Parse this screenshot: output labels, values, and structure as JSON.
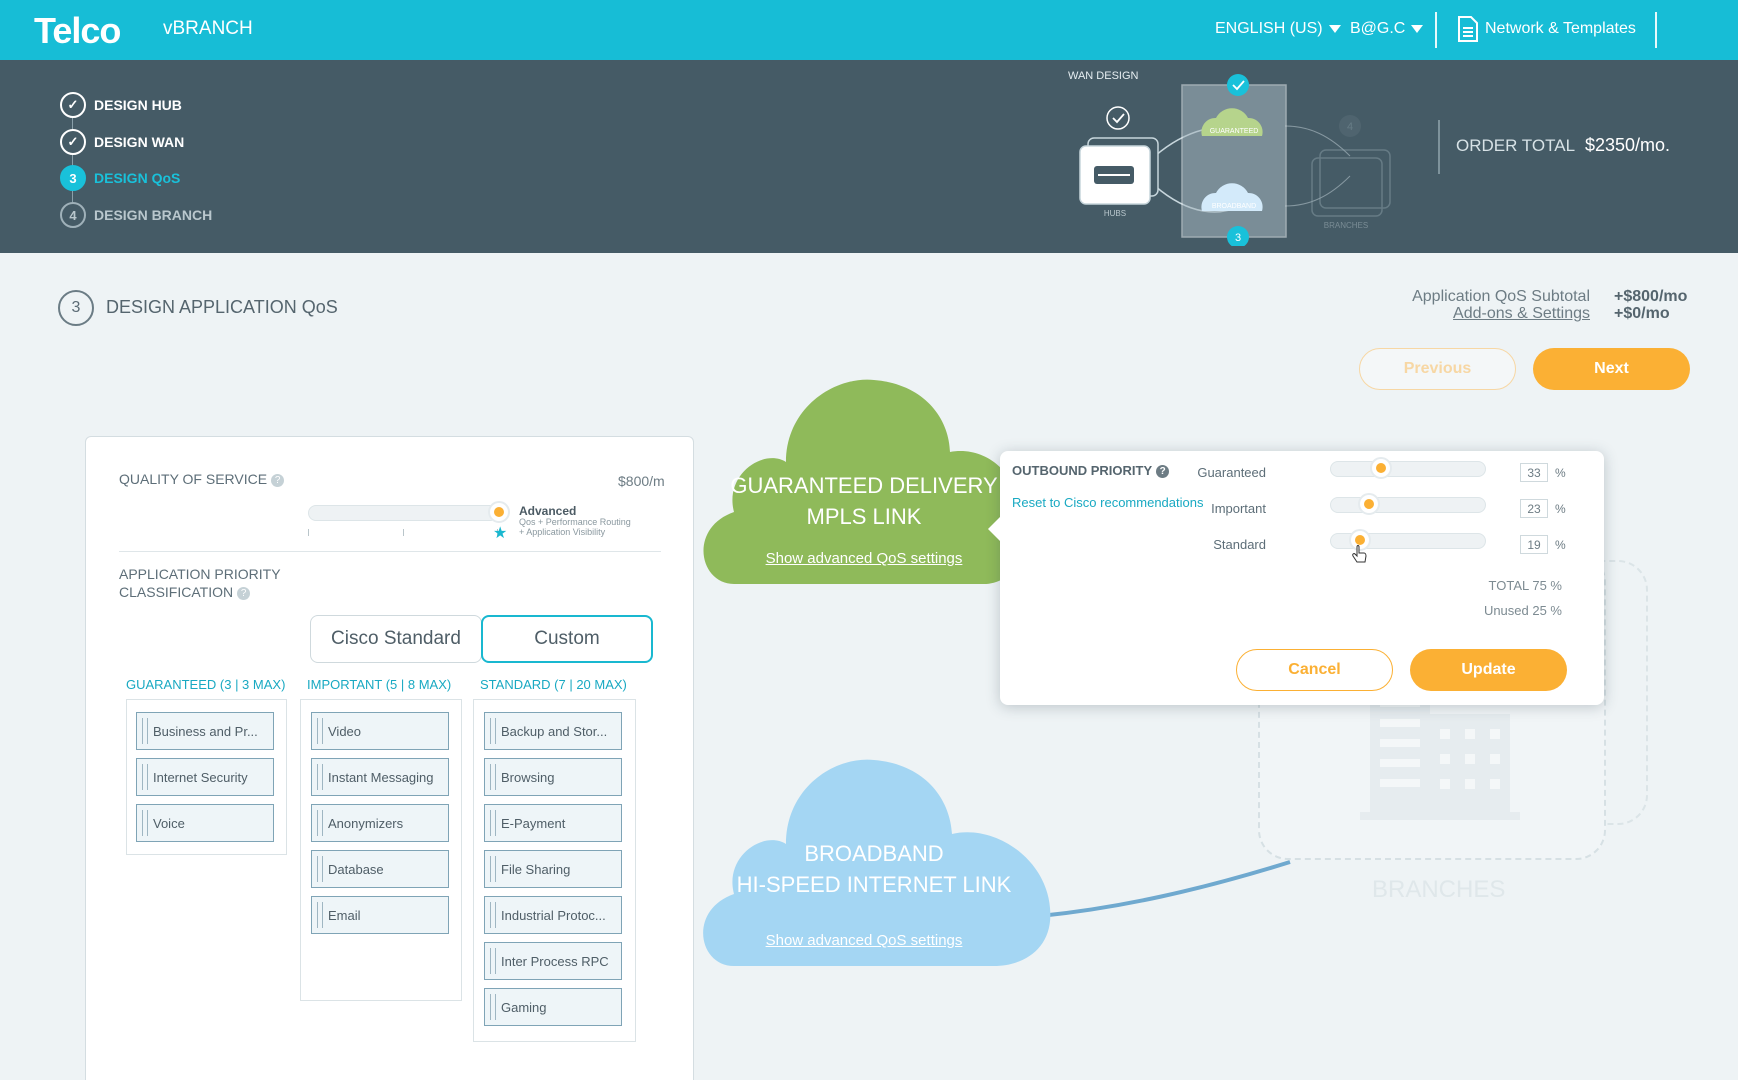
{
  "header": {
    "logo": "Telco",
    "app": "vBRANCH",
    "language": "ENGLISH (US)",
    "user": "B@G.C",
    "network_templates": "Network & Templates"
  },
  "steps": [
    {
      "num": "",
      "label": "DESIGN HUB",
      "state": "done"
    },
    {
      "num": "",
      "label": "DESIGN WAN",
      "state": "done"
    },
    {
      "num": "3",
      "label": "DESIGN QoS",
      "state": "active"
    },
    {
      "num": "4",
      "label": "DESIGN BRANCH",
      "state": "pending"
    }
  ],
  "wan_design": {
    "title": "WAN DESIGN",
    "hubs": "HUBS",
    "guaranteed": "GUARANTEED",
    "broadband": "BROADBAND",
    "branches": "BRANCHES",
    "badge_bottom": "3",
    "badge_right": "4"
  },
  "order": {
    "label": "ORDER TOTAL",
    "value": "$2350/mo."
  },
  "page": {
    "step_num": "3",
    "title": "DESIGN APPLICATION QoS",
    "subtotal_label": "Application QoS Subtotal",
    "subtotal_value": "+$800/mo",
    "addons_label": "Add-ons & Settings",
    "addons_value": "+$0/mo",
    "previous": "Previous",
    "next": "Next"
  },
  "qos_panel": {
    "title": "QUALITY OF SERVICE",
    "price": "$800/m",
    "level_name": "Advanced",
    "level_desc_1": "Qos + Performance Routing",
    "level_desc_2": "+ Application Visibility",
    "level_position": 1.0,
    "classification_1": "APPLICATION PRIORITY",
    "classification_2": "CLASSIFICATION",
    "toggle_standard": "Cisco Standard",
    "toggle_custom": "Custom",
    "columns": [
      {
        "heading": "GUARANTEED (3 | 3 MAX)",
        "items": [
          "Business and Pr...",
          "Internet Security",
          "Voice"
        ]
      },
      {
        "heading": "IMPORTANT (5 | 8 MAX)",
        "items": [
          "Video",
          "Instant Messaging",
          "Anonymizers",
          "Database",
          "Email"
        ]
      },
      {
        "heading": "STANDARD (7 | 20 MAX)",
        "items": [
          "Backup and Stor...",
          "Browsing",
          "E-Payment",
          "File Sharing",
          "Industrial Protoc...",
          "Inter Process RPC",
          "Gaming"
        ]
      }
    ]
  },
  "clouds": {
    "guaranteed_line1": "GUARANTEED DELIVERY",
    "guaranteed_line2": "MPLS LINK",
    "broadband_line1": "BROADBAND",
    "broadband_line2": "HI-SPEED INTERNET LINK",
    "show_advanced": "Show advanced QoS settings",
    "guaranteed_color": "#8fba5a",
    "broadband_color": "#a4d6f3"
  },
  "branches_label": "BRANCHES",
  "popover": {
    "title": "OUTBOUND PRIORITY",
    "reset": "Reset to Cisco recommendations",
    "priorities": [
      {
        "label": "Guaranteed",
        "value": "33",
        "pct": "%"
      },
      {
        "label": "Important",
        "value": "23",
        "pct": "%"
      },
      {
        "label": "Standard",
        "value": "19",
        "pct": "%"
      }
    ],
    "total": "TOTAL   75 %",
    "unused": "Unused 25 %",
    "cancel": "Cancel",
    "update": "Update"
  },
  "colors": {
    "accent": "#17bdd6",
    "orange": "#fbb034",
    "header_dark": "#455b66"
  }
}
